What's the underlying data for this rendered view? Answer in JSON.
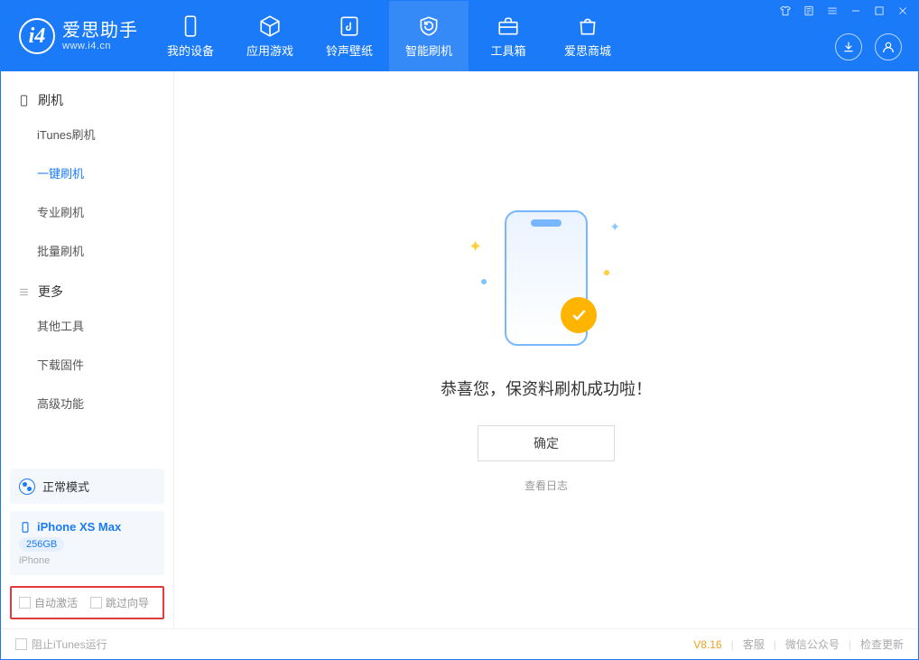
{
  "app": {
    "title": "爱思助手",
    "subtitle": "www.i4.cn"
  },
  "nav": {
    "mydevice": "我的设备",
    "apps": "应用游戏",
    "ringtone": "铃声壁纸",
    "flash": "智能刷机",
    "toolbox": "工具箱",
    "store": "爱思商城"
  },
  "sidebar": {
    "section_flash": "刷机",
    "items_flash": {
      "itunes": "iTunes刷机",
      "oneclick": "一键刷机",
      "pro": "专业刷机",
      "batch": "批量刷机"
    },
    "section_more": "更多",
    "items_more": {
      "other": "其他工具",
      "firmware": "下载固件",
      "advanced": "高级功能"
    }
  },
  "device": {
    "mode": "正常模式",
    "name": "iPhone XS Max",
    "capacity": "256GB",
    "type": "iPhone"
  },
  "checkboxes": {
    "auto_activate": "自动激活",
    "skip_guide": "跳过向导"
  },
  "main": {
    "success_title": "恭喜您，保资料刷机成功啦！",
    "confirm": "确定",
    "view_log": "查看日志"
  },
  "footer": {
    "block_itunes": "阻止iTunes运行",
    "version": "V8.16",
    "support": "客服",
    "wechat": "微信公众号",
    "check_update": "检查更新"
  }
}
